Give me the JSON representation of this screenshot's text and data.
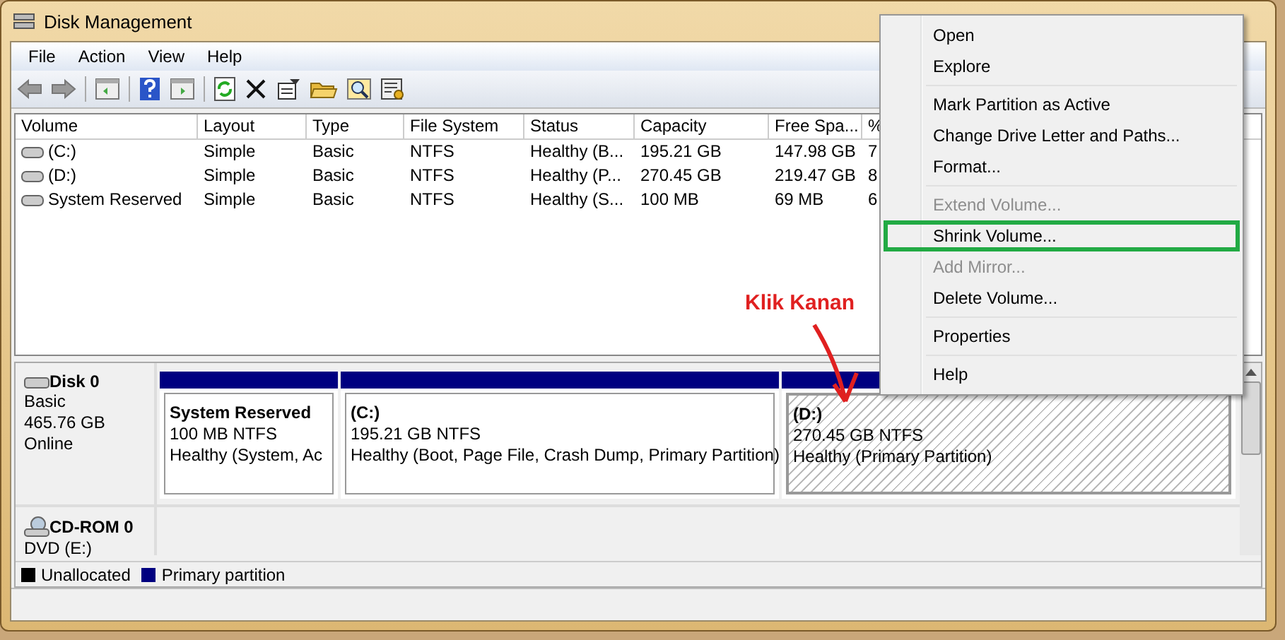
{
  "window": {
    "title": "Disk Management"
  },
  "menu_bar": [
    "File",
    "Action",
    "View",
    "Help"
  ],
  "toolbar": [
    {
      "kind": "back"
    },
    {
      "kind": "forward"
    },
    {
      "kind": "sep"
    },
    {
      "kind": "panel"
    },
    {
      "kind": "sep"
    },
    {
      "kind": "help"
    },
    {
      "kind": "panel2"
    },
    {
      "kind": "sep"
    },
    {
      "kind": "refresh"
    },
    {
      "kind": "delete"
    },
    {
      "kind": "properties"
    },
    {
      "kind": "open"
    },
    {
      "kind": "search"
    },
    {
      "kind": "settings"
    }
  ],
  "table": {
    "columns": [
      "Volume",
      "Layout",
      "Type",
      "File System",
      "Status",
      "Capacity",
      "Free Spa...",
      "%"
    ],
    "rows": [
      [
        "(C:)",
        "Simple",
        "Basic",
        "NTFS",
        "Healthy (B...",
        "195.21 GB",
        "147.98 GB",
        "7"
      ],
      [
        "(D:)",
        "Simple",
        "Basic",
        "NTFS",
        "Healthy (P...",
        "270.45 GB",
        "219.47 GB",
        "8"
      ],
      [
        "System Reserved",
        "Simple",
        "Basic",
        "NTFS",
        "Healthy (S...",
        "100 MB",
        "69 MB",
        "6"
      ]
    ]
  },
  "disks": [
    {
      "name": "Disk 0",
      "lines": [
        "Basic",
        "465.76 GB",
        "Online"
      ],
      "kind": "disk",
      "partitions": [
        {
          "name": "System Reserved",
          "size": "100 MB NTFS",
          "status": "Healthy (System, Ac",
          "selected": false
        },
        {
          "name": "(C:)",
          "size": "195.21 GB NTFS",
          "status": "Healthy (Boot, Page File, Crash Dump, Primary Partition)",
          "selected": false
        },
        {
          "name": "(D:)",
          "size": "270.45 GB NTFS",
          "status": "Healthy (Primary Partition)",
          "selected": true
        }
      ]
    },
    {
      "name": "CD-ROM 0",
      "lines": [
        "DVD (E:)"
      ],
      "kind": "cdrom"
    }
  ],
  "legend": [
    {
      "label": "Unallocated",
      "color": "#000000"
    },
    {
      "label": "Primary partition",
      "color": "#000080"
    }
  ],
  "annotation": {
    "text": "Klik Kanan"
  },
  "context_menu": [
    {
      "kind": "item",
      "label": "Open",
      "disabled": false,
      "boxed": false
    },
    {
      "kind": "item",
      "label": "Explore",
      "disabled": false,
      "boxed": false
    },
    {
      "kind": "separator"
    },
    {
      "kind": "item",
      "label": "Mark Partition as Active",
      "disabled": false,
      "boxed": false
    },
    {
      "kind": "item",
      "label": "Change Drive Letter and Paths...",
      "disabled": false,
      "boxed": false
    },
    {
      "kind": "item",
      "label": "Format...",
      "disabled": false,
      "boxed": false
    },
    {
      "kind": "separator"
    },
    {
      "kind": "item",
      "label": "Extend Volume...",
      "disabled": true,
      "boxed": false
    },
    {
      "kind": "item",
      "label": "Shrink Volume...",
      "disabled": false,
      "boxed": true
    },
    {
      "kind": "item",
      "label": "Add Mirror...",
      "disabled": true,
      "boxed": false
    },
    {
      "kind": "item",
      "label": "Delete Volume...",
      "disabled": false,
      "boxed": false
    },
    {
      "kind": "separator"
    },
    {
      "kind": "item",
      "label": "Properties",
      "disabled": false,
      "boxed": false
    },
    {
      "kind": "separator"
    },
    {
      "kind": "item",
      "label": "Help",
      "disabled": false,
      "boxed": false
    }
  ]
}
